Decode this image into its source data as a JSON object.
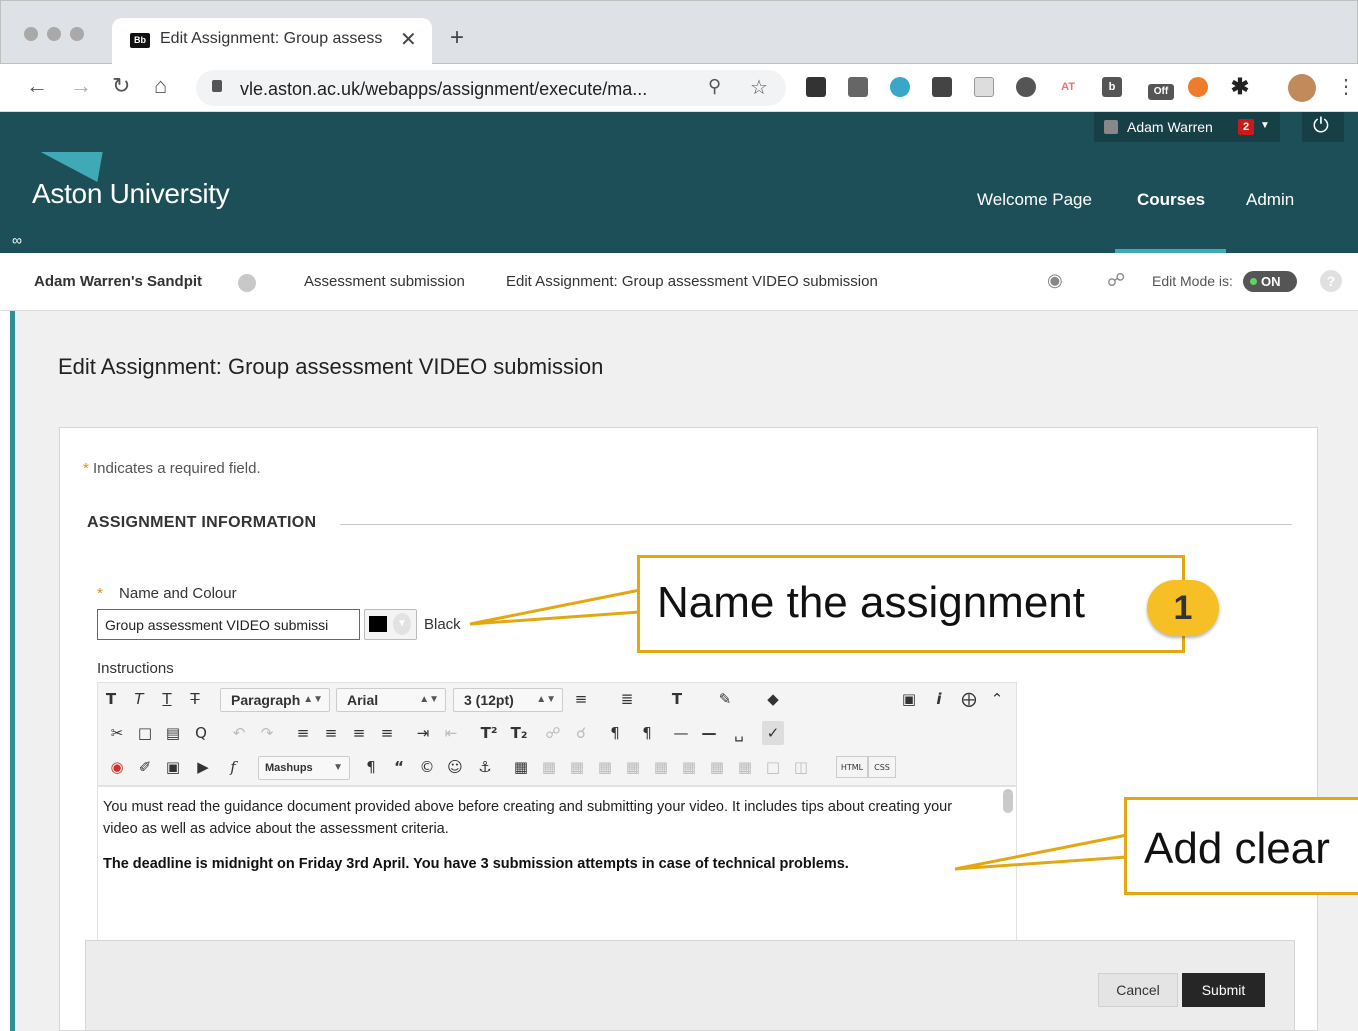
{
  "browser": {
    "tab_favicon": "Bb",
    "tab_title": "Edit Assignment: Group assess",
    "tab_close": "✕",
    "new_tab": "+",
    "url": "vle.aston.ac.uk/webapps/assignment/execute/ma...",
    "extensions": [
      "AT",
      "b",
      "Off"
    ]
  },
  "header": {
    "logo_text": "Aston University",
    "user_name": "Adam Warren",
    "notification_count": "2",
    "nav": [
      "Welcome Page",
      "Courses",
      "Admin"
    ],
    "active_nav": "Courses",
    "colors": {
      "header_bg": "#1c4f58",
      "accent": "#3fa9b5"
    }
  },
  "breadcrumb": {
    "course": "Adam Warren's Sandpit",
    "items": [
      "Assessment submission",
      "Edit Assignment: Group assessment VIDEO submission"
    ],
    "edit_mode_label": "Edit Mode is:",
    "edit_mode_value": "ON",
    "help": "?"
  },
  "page": {
    "title": "Edit Assignment: Group assessment VIDEO submission",
    "required_note": "Indicates a required field.",
    "required_star": "*",
    "section_title": "ASSIGNMENT INFORMATION"
  },
  "form": {
    "name_label": "Name and Colour",
    "name_value": "Group assessment VIDEO submissi",
    "color_name": "Black",
    "instructions_label": "Instructions"
  },
  "editor": {
    "paragraph_select": "Paragraph",
    "font_select": "Arial",
    "size_select": "3 (12pt)",
    "mashups_label": "Mashups",
    "html_label": "HTML",
    "css_label": "CSS",
    "body_p1": "You must read the guidance document provided above before creating and submitting your video. It includes tips about creating your video as well as advice about the assessment criteria.",
    "body_p2": "The deadline is midnight on Friday 3rd April. You have 3 submission attempts in case of technical problems."
  },
  "actions": {
    "cancel": "Cancel",
    "submit": "Submit"
  },
  "callouts": {
    "c1_text": "Name the assignment",
    "c1_number": "1",
    "c2_text": "Add clear",
    "border_color": "#e3a712",
    "badge_color": "#f6bf26"
  }
}
